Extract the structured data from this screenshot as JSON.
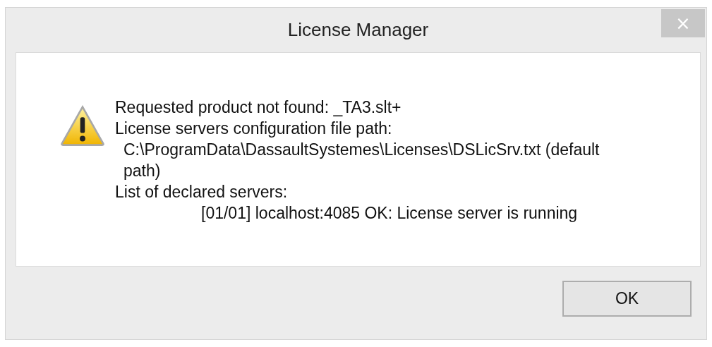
{
  "window": {
    "title": "License Manager",
    "close": "×"
  },
  "message": {
    "lines": [
      {
        "kind": "plain",
        "text": "Requested product not found: _TA3.slt+"
      },
      {
        "kind": "plain",
        "text": "License servers configuration file path:"
      },
      {
        "kind": "indented",
        "text": "C:\\ProgramData\\DassaultSystemes\\Licenses\\DSLicSrv.txt (default path)"
      },
      {
        "kind": "plain",
        "text": "List of declared servers:"
      },
      {
        "kind": "nested",
        "text": "[01/01] localhost:4085 OK: License server is running"
      }
    ]
  },
  "buttons": [
    {
      "label": "OK"
    }
  ]
}
